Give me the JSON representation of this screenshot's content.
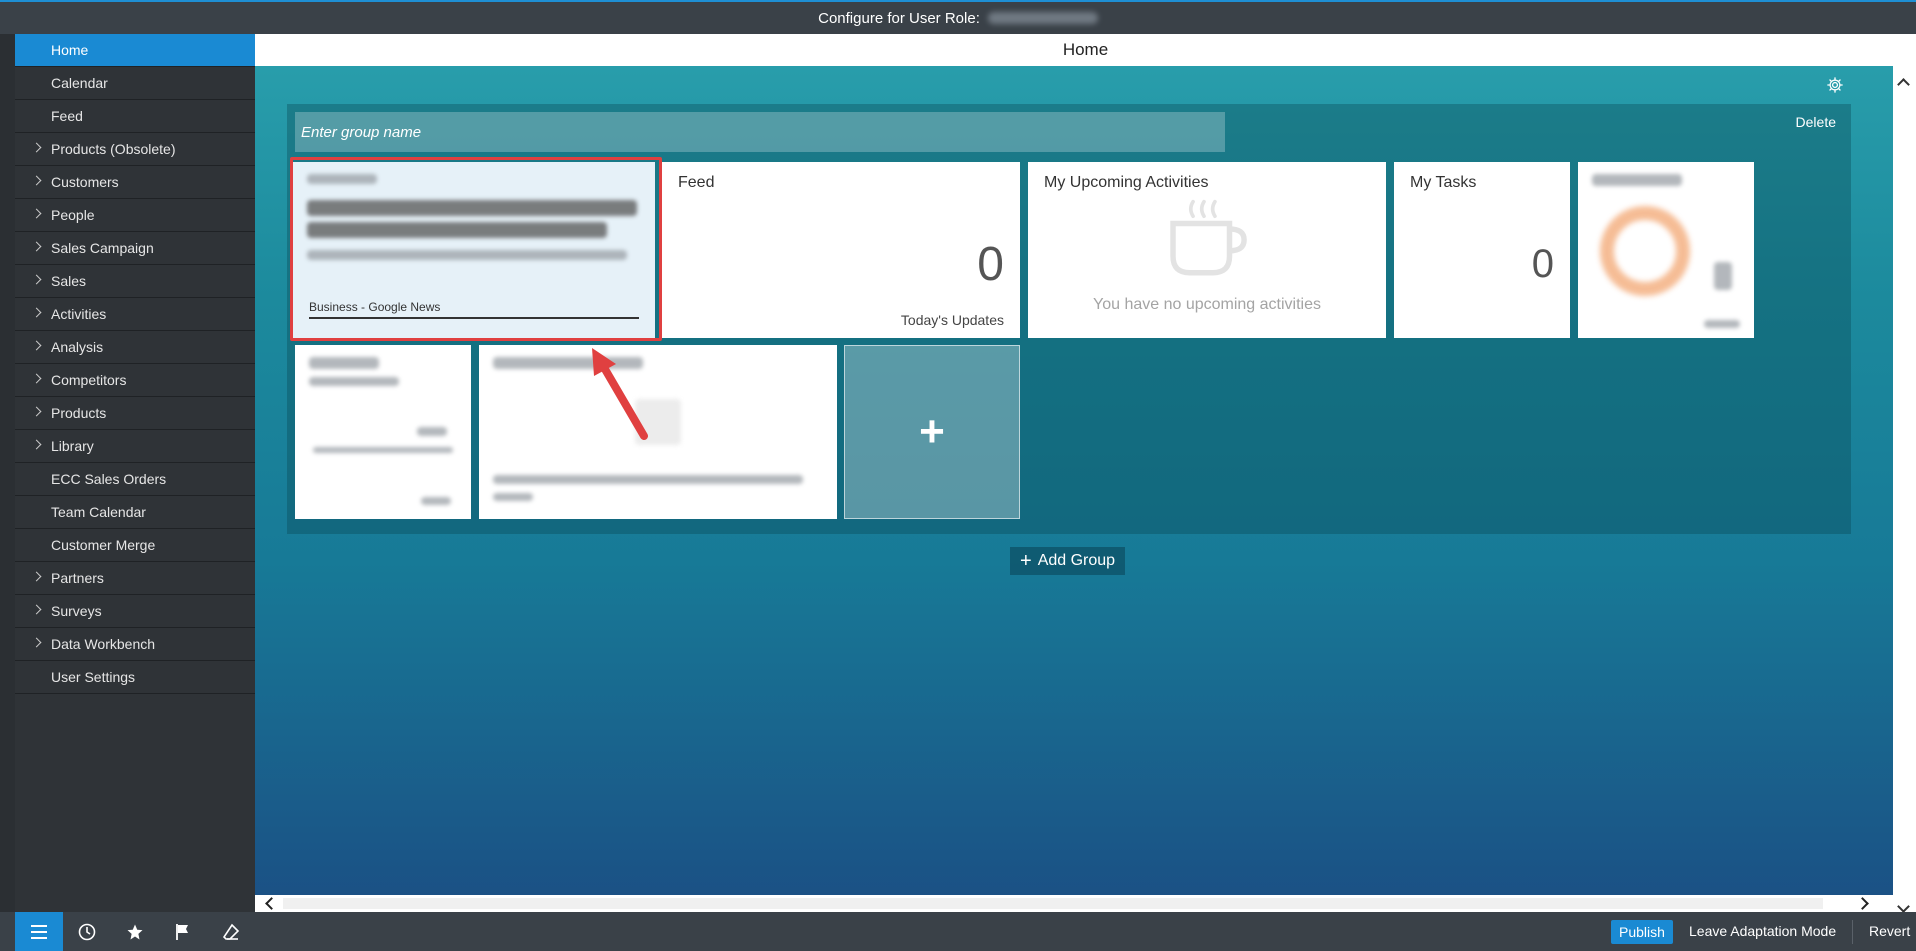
{
  "topbar": {
    "title": "Configure for User Role:"
  },
  "sidebar": {
    "items": [
      {
        "label": "Home",
        "expandable": false,
        "active": true
      },
      {
        "label": "Calendar",
        "expandable": false
      },
      {
        "label": "Feed",
        "expandable": false
      },
      {
        "label": "Products (Obsolete)",
        "expandable": true
      },
      {
        "label": "Customers",
        "expandable": true
      },
      {
        "label": "People",
        "expandable": true
      },
      {
        "label": "Sales Campaign",
        "expandable": true
      },
      {
        "label": "Sales",
        "expandable": true
      },
      {
        "label": "Activities",
        "expandable": true
      },
      {
        "label": "Analysis",
        "expandable": true
      },
      {
        "label": "Competitors",
        "expandable": true
      },
      {
        "label": "Products",
        "expandable": true
      },
      {
        "label": "Library",
        "expandable": true
      },
      {
        "label": "ECC Sales Orders",
        "expandable": false
      },
      {
        "label": "Team Calendar",
        "expandable": false
      },
      {
        "label": "Customer Merge",
        "expandable": false
      },
      {
        "label": "Partners",
        "expandable": true
      },
      {
        "label": "Surveys",
        "expandable": true
      },
      {
        "label": "Data Workbench",
        "expandable": true
      },
      {
        "label": "User Settings",
        "expandable": false
      }
    ]
  },
  "main": {
    "header": "Home",
    "group": {
      "name_placeholder": "Enter group name",
      "delete_label": "Delete"
    },
    "tiles": {
      "news": {
        "source": "Business - Google News"
      },
      "feed": {
        "title": "Feed",
        "count": "0",
        "subtitle": "Today's Updates"
      },
      "activities": {
        "title": "My Upcoming Activities",
        "empty_text": "You have no upcoming activities"
      },
      "tasks": {
        "title": "My Tasks",
        "count": "0"
      },
      "add": {
        "symbol": "+"
      }
    },
    "add_group": {
      "symbol": "+",
      "label": "Add Group"
    }
  },
  "footer": {
    "publish": "Publish",
    "leave": "Leave Adaptation Mode",
    "revert": "Revert"
  },
  "colors": {
    "accent": "#1a8ad3",
    "highlight": "#e04040"
  }
}
